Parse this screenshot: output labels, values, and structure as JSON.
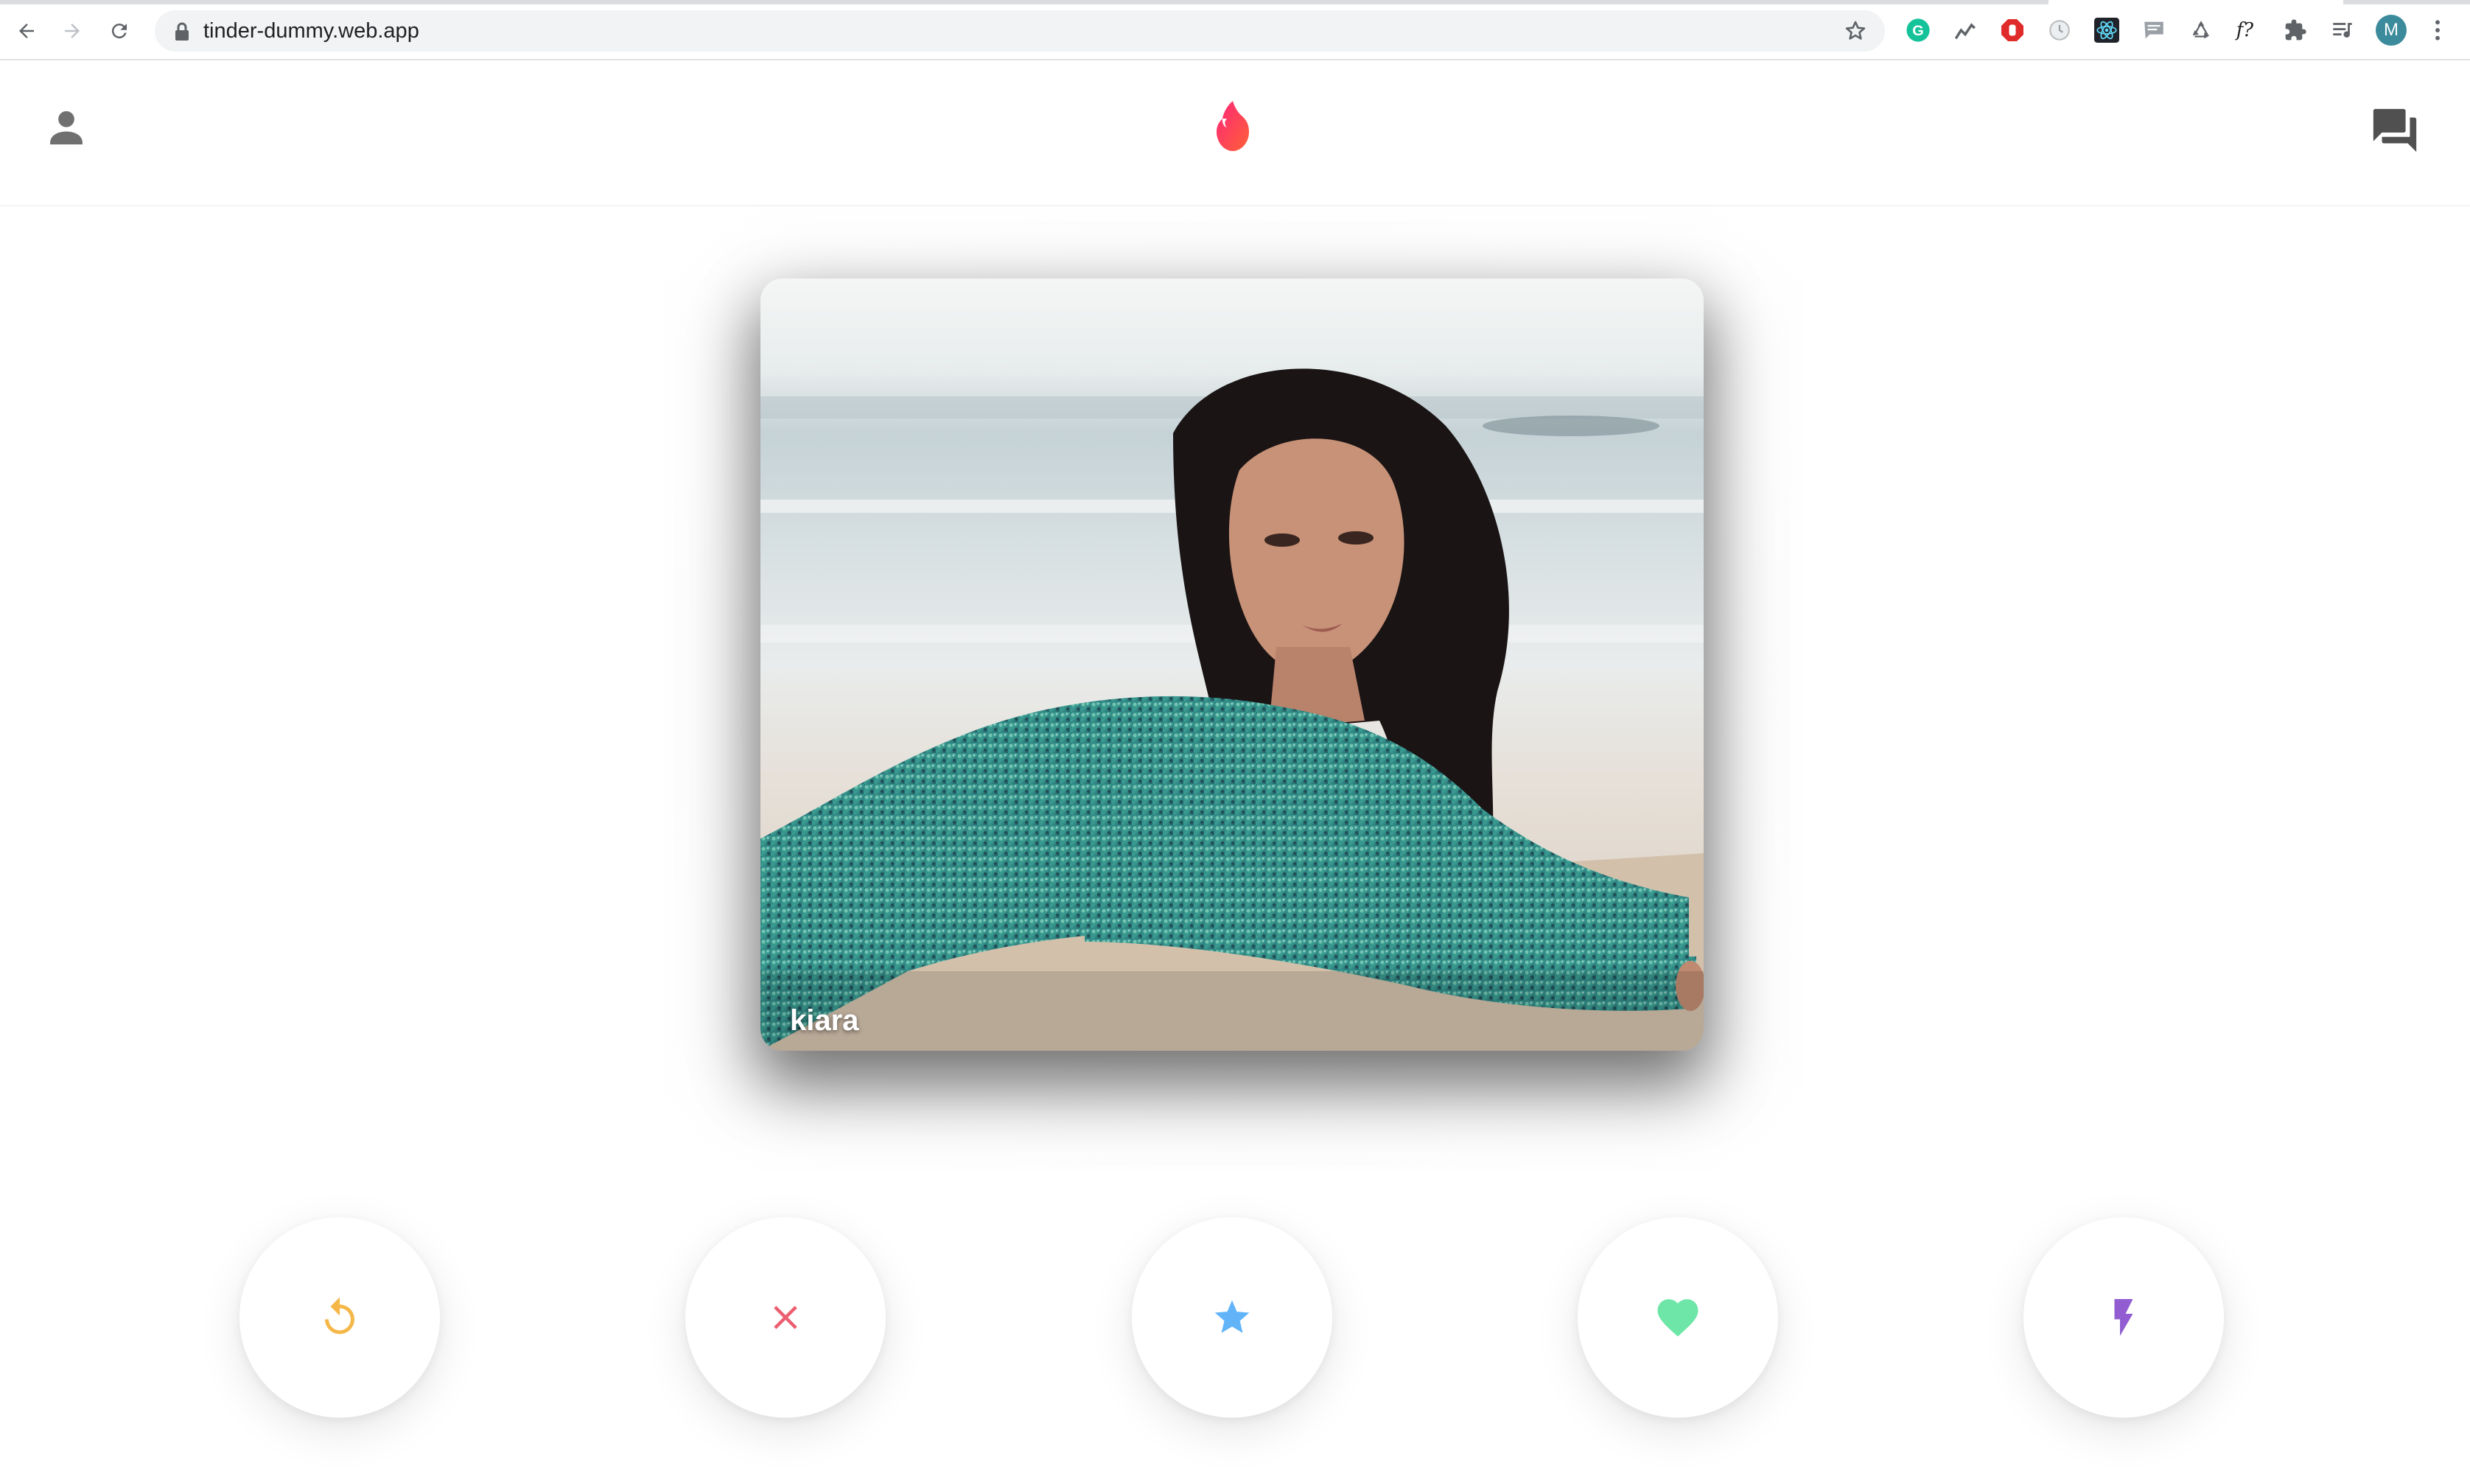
{
  "browser": {
    "url": "tinder-dummy.web.app",
    "profile_initial": "M",
    "extensions": [
      "grammarly-icon",
      "analytics-icon",
      "adblock-icon",
      "timer-icon",
      "react-devtools-icon",
      "comment-icon",
      "recycle-icon",
      "whatfont-icon",
      "puzzle-icon",
      "media-queue-icon"
    ]
  },
  "header": {
    "profile_icon": "person-icon",
    "logo_icon": "flame-icon",
    "chat_icon": "forum-icon",
    "accent": "#fd5068"
  },
  "card": {
    "name": "kiara",
    "photo": "woman-lying-on-beach-photo"
  },
  "actions": [
    {
      "id": "rewind",
      "icon": "replay-icon",
      "color": "#f5b748"
    },
    {
      "id": "nope",
      "icon": "close-icon",
      "color": "#ec5e6f"
    },
    {
      "id": "super-like",
      "icon": "star-icon",
      "color": "#62b4f9"
    },
    {
      "id": "like",
      "icon": "heart-icon",
      "color": "#6ee6a8"
    },
    {
      "id": "boost",
      "icon": "flash-icon",
      "color": "#915dd1"
    }
  ]
}
